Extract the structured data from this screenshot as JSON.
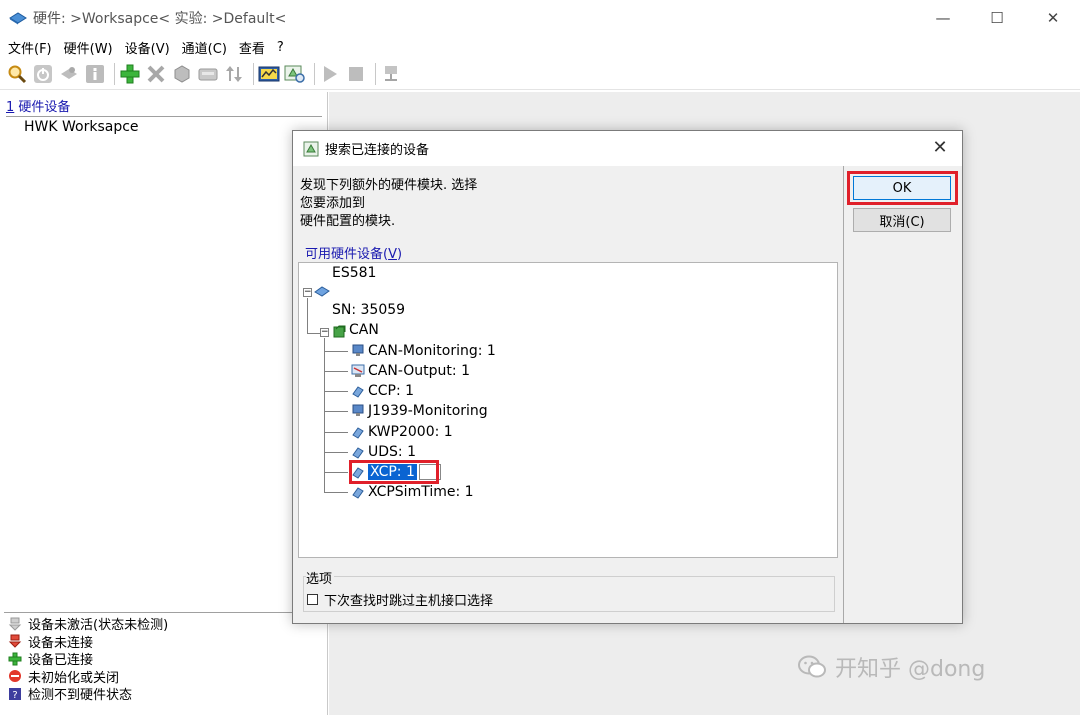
{
  "window": {
    "title": "硬件: >Worksapce<  实验: >Default<",
    "minimize": "—",
    "maximize": "☐",
    "close": "✕"
  },
  "menu": [
    "文件(F)",
    "硬件(W)",
    "设备(V)",
    "通道(C)",
    "查看",
    "?"
  ],
  "left_pane": {
    "tab_number": "1",
    "tab_label": " 硬件设备",
    "tree_root": "HWK Worksapce",
    "legend": [
      {
        "icon": "device-inactive-icon",
        "label": "设备未激活(状态未检测)"
      },
      {
        "icon": "device-disconnected-icon",
        "label": "设备未连接"
      },
      {
        "icon": "device-connected-icon",
        "label": "设备已连接"
      },
      {
        "icon": "not-initialized-icon",
        "label": "未初始化或关闭"
      },
      {
        "icon": "unknown-status-icon",
        "label": "检测不到硬件状态"
      }
    ]
  },
  "dialog": {
    "title": "搜索已连接的设备",
    "close": "✕",
    "description": [
      "发现下列额外的硬件模块. 选择",
      "您要添加到",
      "硬件配置的模块."
    ],
    "available_label": "可用硬件设备(",
    "available_hotkey": "V",
    "available_label_end": ")",
    "tree": {
      "device": "ES581",
      "sn": "SN:  35059",
      "can": "CAN",
      "children": [
        "CAN-Monitoring: 1",
        "CAN-Output: 1",
        "CCP: 1",
        "J1939-Monitoring",
        "KWP2000: 1",
        "UDS: 1",
        "XCP: 1",
        "XCPSimTime: 1"
      ],
      "selected_index": 6
    },
    "options": {
      "group_title": "选项",
      "skip_label": "下次查找时跳过主机接口选择"
    },
    "ok_label": "OK",
    "cancel_label": "取消(C)"
  },
  "watermark": "开知乎 @dong",
  "colors": {
    "highlight": "#e0202a",
    "selection": "#0a64d2",
    "link": "#1a1ab0"
  }
}
